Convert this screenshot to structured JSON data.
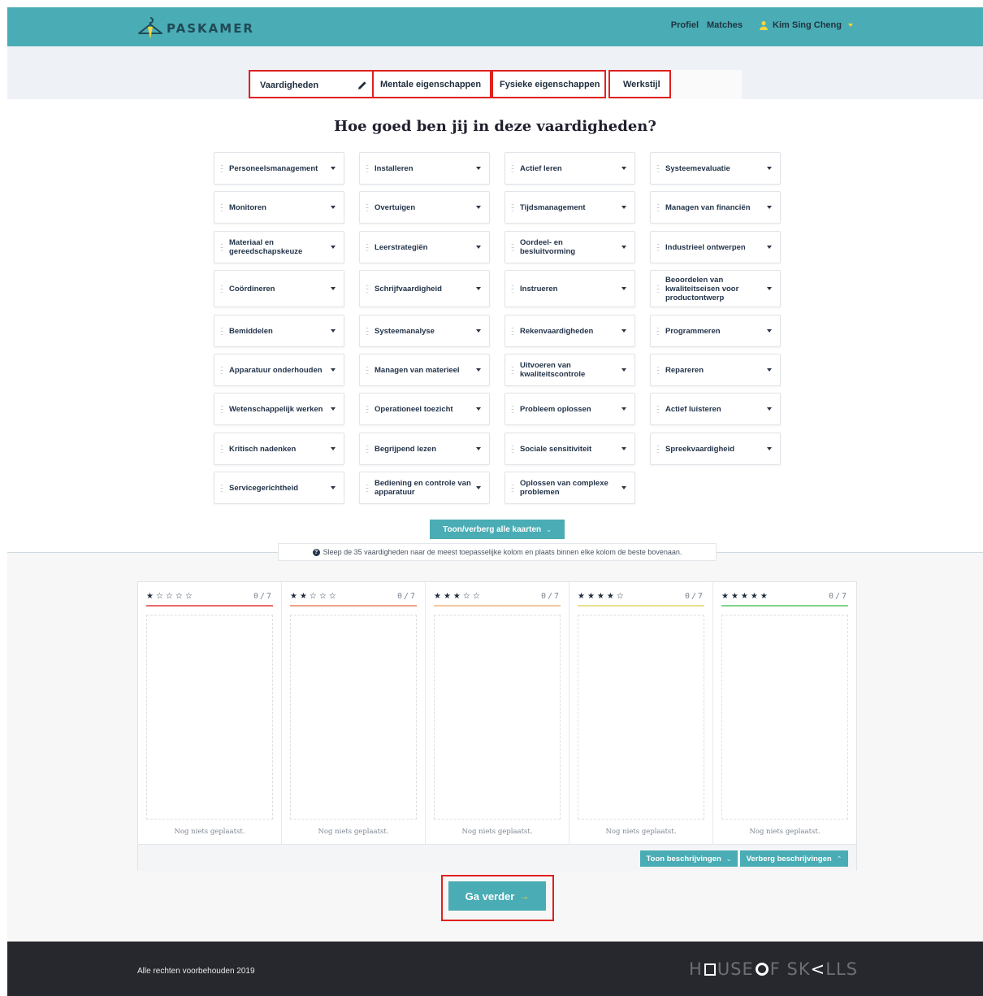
{
  "app": {
    "logo_text": "PASKAMER"
  },
  "nav": {
    "profile": "Profiel",
    "matches": "Matches",
    "user_name": "Kim Sing Cheng"
  },
  "tabs": [
    {
      "label": "Vaardigheden",
      "active": true
    },
    {
      "label": "Mentale eigenschappen"
    },
    {
      "label": "Fysieke eigenschappen"
    },
    {
      "label": "Werkstijl"
    }
  ],
  "main": {
    "heading": "Hoe goed ben jij in deze vaardigheden?",
    "toggle_all_label": "Toon/verberg alle kaarten"
  },
  "skills": [
    [
      "Personeelsmanagement",
      "Installeren",
      "Actief leren",
      "Systeemevaluatie"
    ],
    [
      "Monitoren",
      "Overtuigen",
      "Tijdsmanagement",
      "Managen van financiën"
    ],
    [
      "Materiaal en gereedschapskeuze",
      "Leerstrategiën",
      "Oordeel- en besluitvorming",
      "Industrieel ontwerpen"
    ],
    [
      "Coördineren",
      "Schrijfvaardigheid",
      "Instrueren",
      "Beoordelen van kwaliteitseisen voor productontwerp"
    ],
    [
      "Bemiddelen",
      "Systeemanalyse",
      "Rekenvaardigheden",
      "Programmeren"
    ],
    [
      "Apparatuur onderhouden",
      "Managen van materieel",
      "Uitvoeren van kwaliteitscontrole",
      "Repareren"
    ],
    [
      "Wetenschappelijk werken",
      "Operationeel toezicht",
      "Probleem oplossen",
      "Actief luisteren"
    ],
    [
      "Kritisch nadenken",
      "Begrijpend lezen",
      "Sociale sensitiviteit",
      "Spreekvaardigheid"
    ],
    [
      "Servicegerichtheid",
      "Bediening en controle van apparatuur",
      "Oplossen van complexe problemen"
    ]
  ],
  "info": {
    "text": "Sleep de 35 vaardigheden naar de meest toepasselijke kolom en plaats binnen elke kolom de beste bovenaan."
  },
  "columns": [
    {
      "stars": "★☆☆☆☆",
      "count": "0/7",
      "empty": "Nog niets geplaatst.",
      "color": "#e8696b"
    },
    {
      "stars": "★★☆☆☆",
      "count": "0/7",
      "empty": "Nog niets geplaatst.",
      "color": "#f0a08a"
    },
    {
      "stars": "★★★☆☆",
      "count": "0/7",
      "empty": "Nog niets geplaatst.",
      "color": "#f5c9a0"
    },
    {
      "stars": "★★★★☆",
      "count": "0/7",
      "empty": "Nog niets geplaatst.",
      "color": "#ecdf8a"
    },
    {
      "stars": "★★★★★",
      "count": "0/7",
      "empty": "Nog niets geplaatst.",
      "color": "#7fd68c"
    }
  ],
  "board_footer": {
    "show_desc": "Toon beschrijvingen",
    "hide_desc": "Verberg beschrijvingen"
  },
  "continue_label": "Ga verder",
  "footer": {
    "copyright": "Alle rechten voorbehouden 2019",
    "brand_parts": [
      "H",
      "USE ",
      "F SK",
      "LLS"
    ]
  },
  "colors": {
    "primary": "#4aacb4",
    "accent": "#f0d640",
    "footer_bg": "#26282d",
    "highlight": "#e02020"
  },
  "icons": {
    "logo": "hanger-icon",
    "user": "user-icon",
    "edit": "pencil-icon",
    "drag": "drag-handle-icon",
    "dropdown": "caret-down-icon",
    "info": "info-icon",
    "next": "arrow-right-icon"
  }
}
